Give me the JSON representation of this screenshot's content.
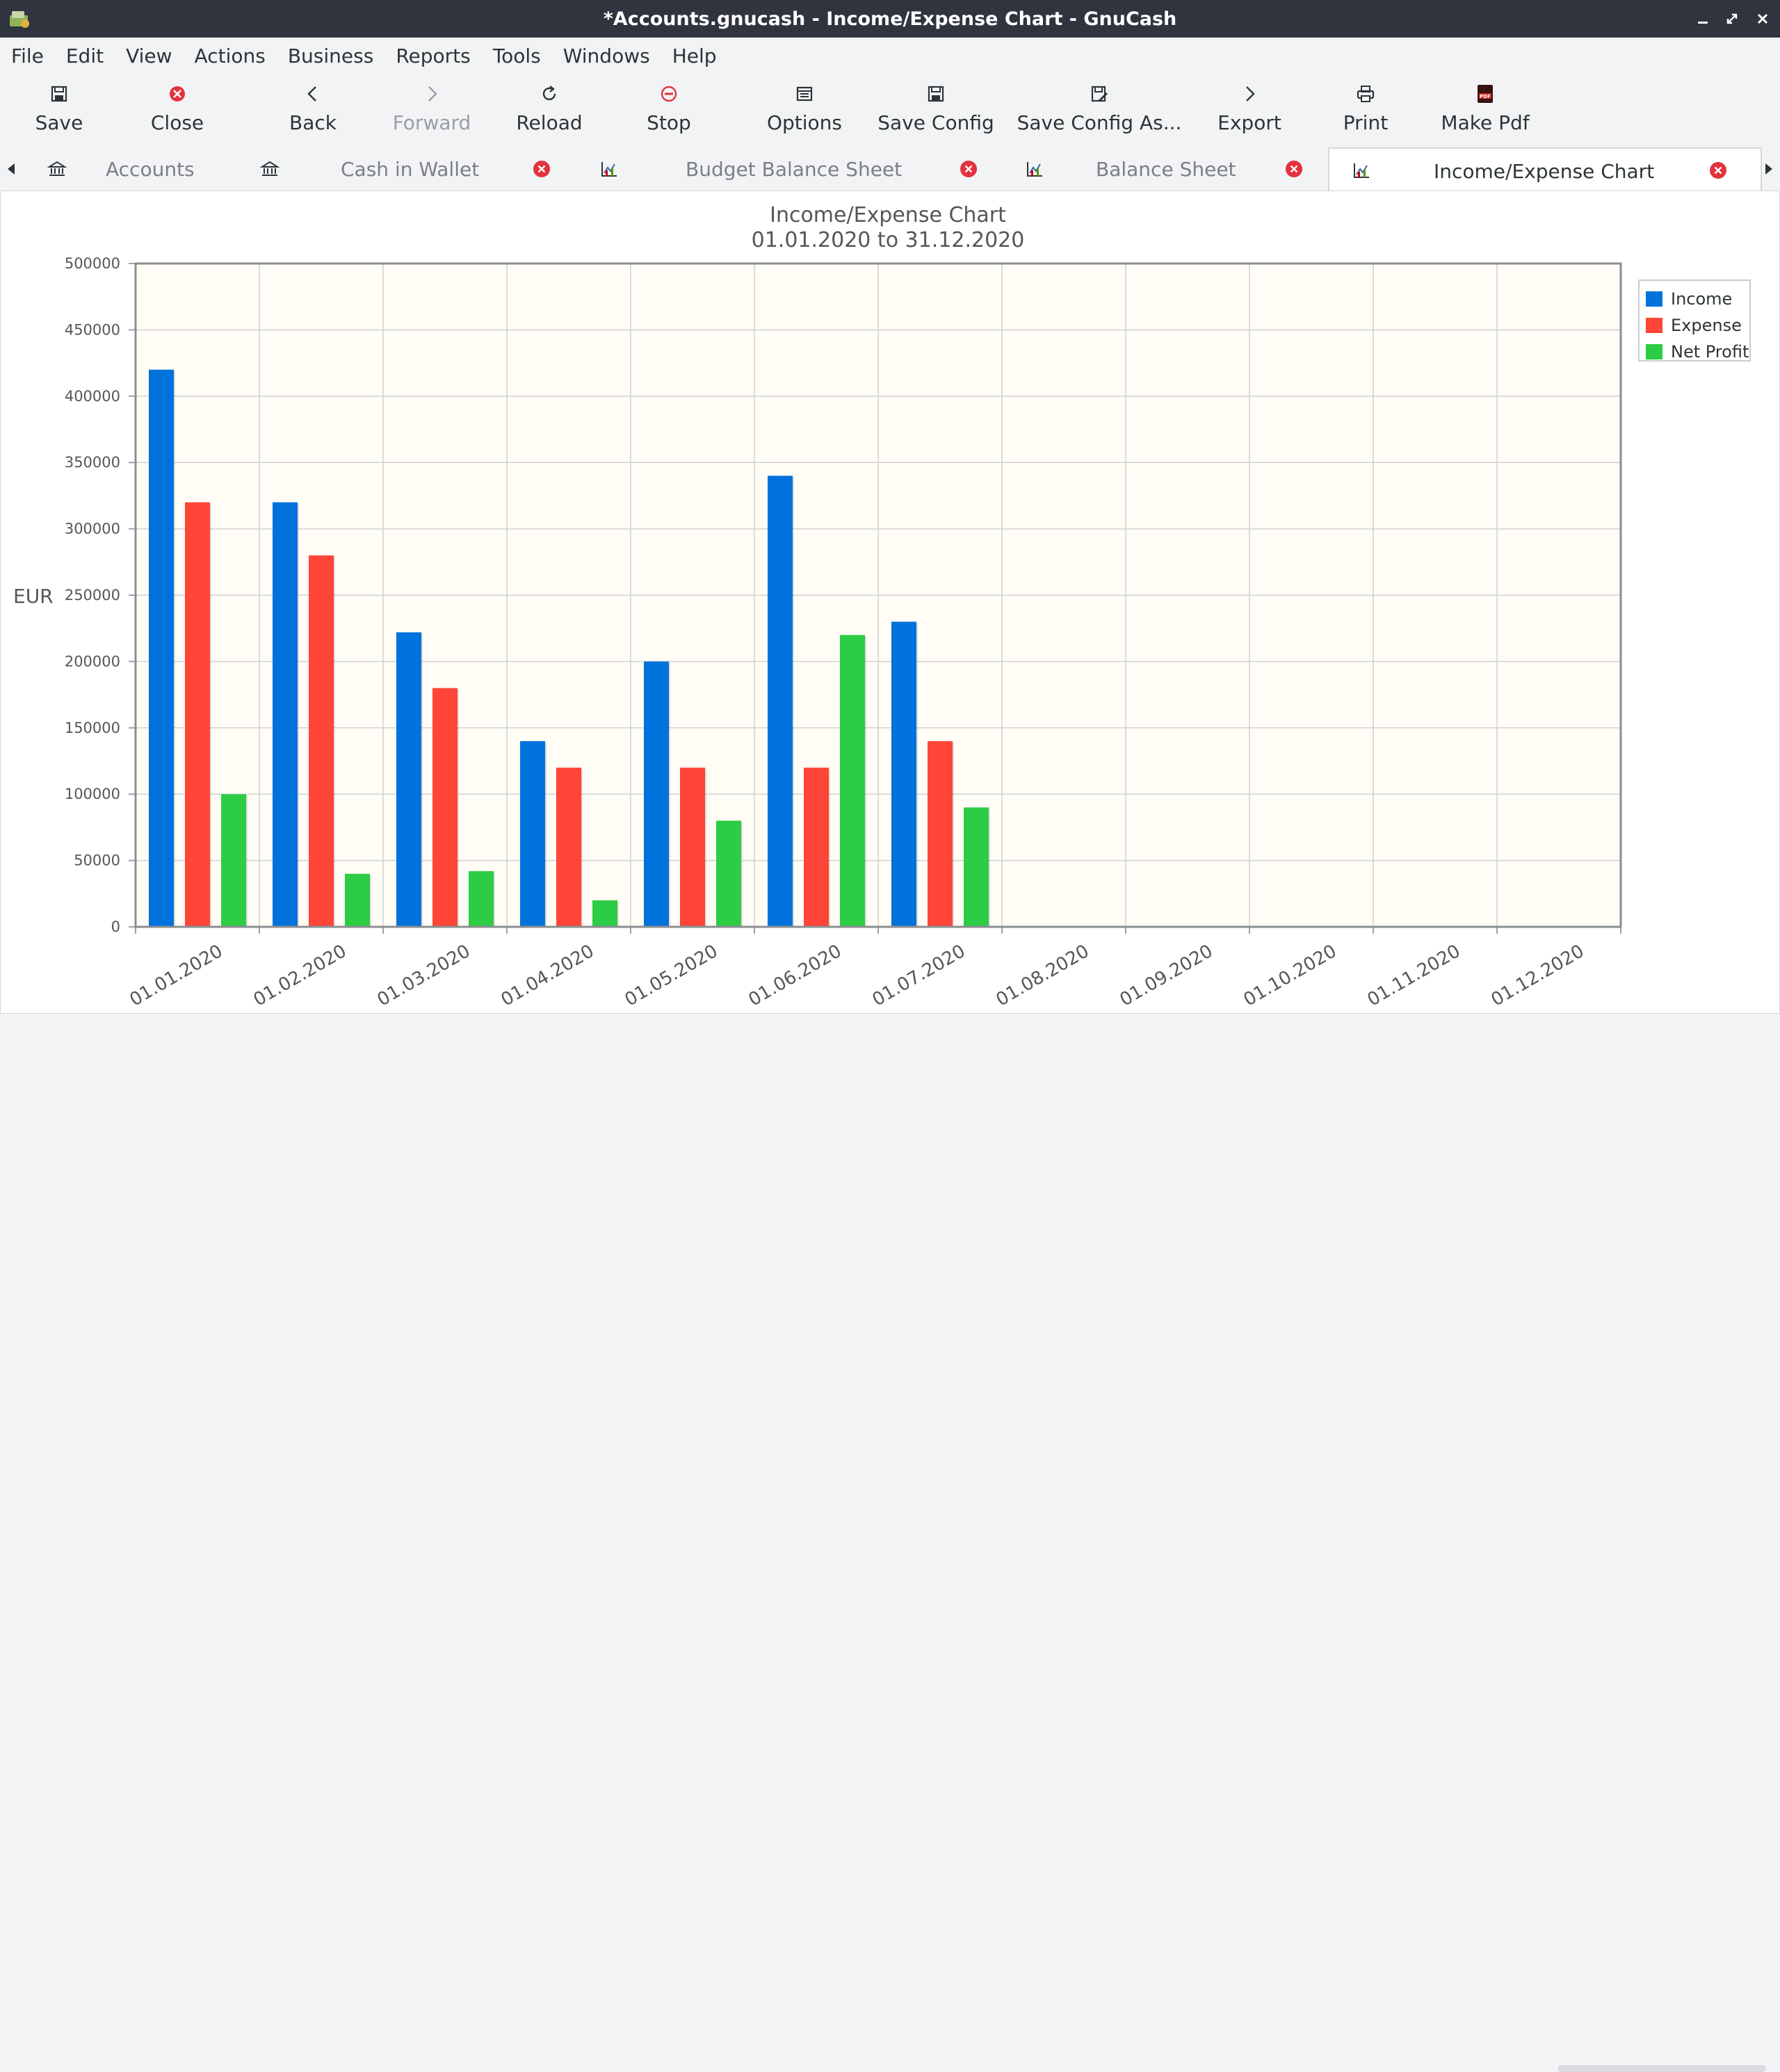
{
  "window": {
    "title": "*Accounts.gnucash - Income/Expense Chart - GnuCash"
  },
  "menu": [
    "File",
    "Edit",
    "View",
    "Actions",
    "Business",
    "Reports",
    "Tools",
    "Windows",
    "Help"
  ],
  "toolbar": {
    "save": "Save",
    "close": "Close",
    "back": "Back",
    "forward": "Forward",
    "reload": "Reload",
    "stop": "Stop",
    "options": "Options",
    "save_config": "Save Config",
    "save_config_as": "Save Config As...",
    "export": "Export",
    "print": "Print",
    "make_pdf": "Make Pdf"
  },
  "tabs": [
    {
      "label": "Accounts",
      "icon": "bank-icon",
      "closable": false,
      "active": false
    },
    {
      "label": "Cash in Wallet",
      "icon": "bank-icon",
      "closable": true,
      "active": false
    },
    {
      "label": "Budget Balance Sheet",
      "icon": "chart-icon",
      "closable": true,
      "active": false
    },
    {
      "label": "Balance Sheet",
      "icon": "chart-icon",
      "closable": true,
      "active": false
    },
    {
      "label": "Income/Expense Chart",
      "icon": "chart-icon",
      "closable": true,
      "active": true
    }
  ],
  "colors": {
    "income": "#0072dc",
    "expense": "#ff4438",
    "net_profit": "#2ccc44",
    "plot_bg": "#fffdf5",
    "titlebar": "#2f343f",
    "close_red": "#e3323e"
  },
  "chart_data": {
    "type": "bar",
    "title": "Income/Expense Chart",
    "subtitle": "01.01.2020 to 31.12.2020",
    "ylabel": "EUR",
    "xlabel": "",
    "ylim": [
      0,
      500000
    ],
    "yticks": [
      "0",
      "50000",
      "100000",
      "150000",
      "200000",
      "250000",
      "300000",
      "350000",
      "400000",
      "450000",
      "500000"
    ],
    "categories": [
      "01.01.2020",
      "01.02.2020",
      "01.03.2020",
      "01.04.2020",
      "01.05.2020",
      "01.06.2020",
      "01.07.2020",
      "01.08.2020",
      "01.09.2020",
      "01.10.2020",
      "01.11.2020",
      "01.12.2020"
    ],
    "series": [
      {
        "name": "Income",
        "values": [
          420000,
          320000,
          222000,
          140000,
          200000,
          340000,
          230000,
          0,
          0,
          0,
          0,
          0
        ]
      },
      {
        "name": "Expense",
        "values": [
          320000,
          280000,
          180000,
          120000,
          120000,
          120000,
          140000,
          0,
          0,
          0,
          0,
          0
        ]
      },
      {
        "name": "Net Profit",
        "values": [
          100000,
          40000,
          42000,
          20000,
          80000,
          220000,
          90000,
          0,
          0,
          0,
          0,
          0
        ]
      }
    ],
    "grid": true,
    "legend_position": "top-right"
  }
}
